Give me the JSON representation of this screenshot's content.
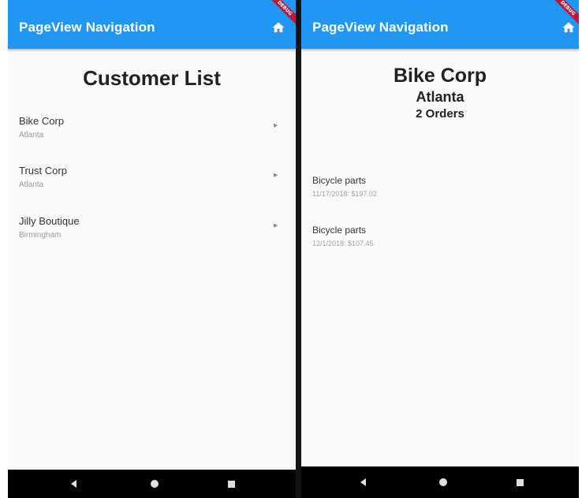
{
  "left_screen": {
    "appbar": {
      "title": "PageView Navigation",
      "action_icon": "home-icon",
      "banner": "DEBUG"
    },
    "heading": "Customer List",
    "customers": [
      {
        "name": "Bike Corp",
        "city": "Atlanta"
      },
      {
        "name": "Trust Corp",
        "city": "Atlanta"
      },
      {
        "name": "Jilly Boutique",
        "city": "Birmingham"
      }
    ],
    "chevron_icon": "chevron-right-icon",
    "navbar": {
      "back_icon": "back-triangle-icon",
      "home_icon": "home-circle-icon",
      "recents_icon": "recents-square-icon"
    }
  },
  "right_screen": {
    "appbar": {
      "title": "PageView Navigation",
      "action_icon": "home-icon",
      "banner": "DEBUG"
    },
    "customer": {
      "name": "Bike Corp",
      "city": "Atlanta",
      "orders_count": "2 Orders"
    },
    "orders": [
      {
        "title": "Bicycle parts",
        "detail": "11/17/2018: $197.02"
      },
      {
        "title": "Bicycle parts",
        "detail": "12/1/2018: $107.45"
      }
    ],
    "navbar": {
      "back_icon": "back-triangle-icon",
      "home_icon": "home-circle-icon",
      "recents_icon": "recents-square-icon"
    }
  },
  "colors": {
    "appbar": "#2196f3",
    "background": "#fafafa",
    "navbar": "#000000",
    "debug_banner": "#b71c3a"
  }
}
